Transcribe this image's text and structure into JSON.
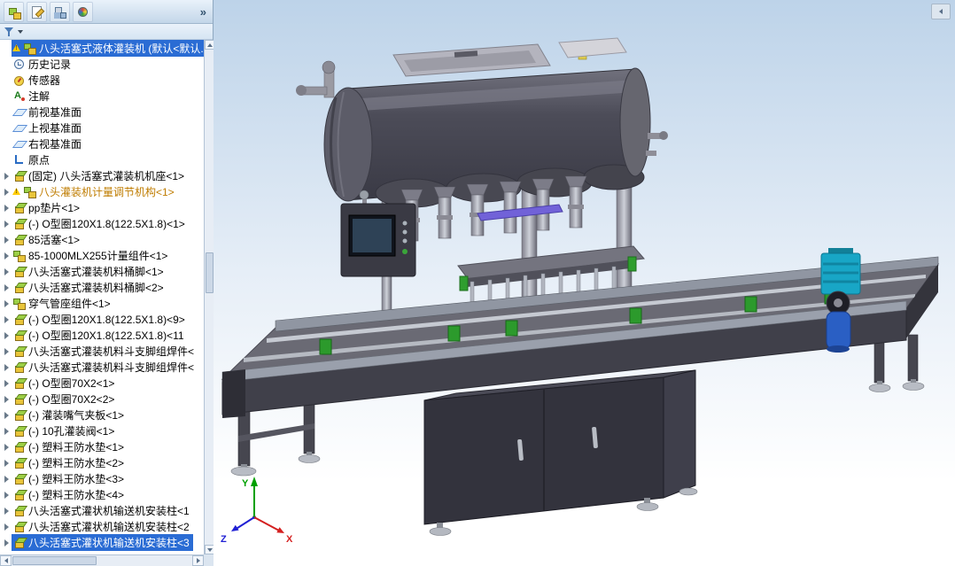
{
  "colors": {
    "selection": "#2a6cd4",
    "warning_text": "#bf7c00"
  },
  "toolbar": {
    "icons": [
      "featuremanager",
      "propertymanager",
      "configurationmanager",
      "displaymanager"
    ],
    "overflow_label": "»"
  },
  "tree": {
    "items": [
      {
        "label": "八头活塞式液体灌装机 (默认<默认...",
        "icon": "asm",
        "warn": true,
        "selected": true
      },
      {
        "label": "历史记录",
        "icon": "history"
      },
      {
        "label": "传感器",
        "icon": "sensor"
      },
      {
        "label": "注解",
        "icon": "annotation"
      },
      {
        "label": "前视基准面",
        "icon": "plane"
      },
      {
        "label": "上视基准面",
        "icon": "plane"
      },
      {
        "label": "右视基准面",
        "icon": "plane"
      },
      {
        "label": "原点",
        "icon": "origin"
      },
      {
        "label": "(固定) 八头活塞式灌装机机座<1>",
        "icon": "part",
        "arrow": true
      },
      {
        "label": "八头灌装机计量调节机构<1>",
        "icon": "asm",
        "arrow": true,
        "warn": true,
        "warntext": true
      },
      {
        "label": "pp垫片<1>",
        "icon": "part",
        "arrow": true
      },
      {
        "label": "(-) O型圈120X1.8(122.5X1.8)<1>",
        "icon": "part",
        "arrow": true
      },
      {
        "label": "85活塞<1>",
        "icon": "part",
        "arrow": true
      },
      {
        "label": "85-1000MLX255计量组件<1>",
        "icon": "asm",
        "arrow": true
      },
      {
        "label": "八头活塞式灌装机料桶脚<1>",
        "icon": "part",
        "arrow": true
      },
      {
        "label": "八头活塞式灌装机料桶脚<2>",
        "icon": "part",
        "arrow": true
      },
      {
        "label": "穿气管座组件<1>",
        "icon": "asm",
        "arrow": true
      },
      {
        "label": "(-) O型圈120X1.8(122.5X1.8)<9>",
        "icon": "part",
        "arrow": true
      },
      {
        "label": "(-) O型圈120X1.8(122.5X1.8)<11",
        "icon": "part",
        "arrow": true
      },
      {
        "label": "八头活塞式灌装机料斗支脚组焊件<",
        "icon": "part",
        "arrow": true
      },
      {
        "label": "八头活塞式灌装机料斗支脚组焊件<",
        "icon": "part",
        "arrow": true
      },
      {
        "label": "(-) O型圈70X2<1>",
        "icon": "part",
        "arrow": true
      },
      {
        "label": "(-) O型圈70X2<2>",
        "icon": "part",
        "arrow": true
      },
      {
        "label": "(-) 灌装嘴气夹板<1>",
        "icon": "part",
        "arrow": true
      },
      {
        "label": "(-) 10孔灌装阀<1>",
        "icon": "part",
        "arrow": true
      },
      {
        "label": "(-) 塑料王防水垫<1>",
        "icon": "part",
        "arrow": true
      },
      {
        "label": "(-) 塑料王防水垫<2>",
        "icon": "part",
        "arrow": true
      },
      {
        "label": "(-) 塑料王防水垫<3>",
        "icon": "part",
        "arrow": true
      },
      {
        "label": "(-) 塑料王防水垫<4>",
        "icon": "part",
        "arrow": true
      },
      {
        "label": "八头活塞式灌状机输送机安装柱<1",
        "icon": "part",
        "arrow": true
      },
      {
        "label": "八头活塞式灌状机输送机安装柱<2",
        "icon": "part",
        "arrow": true
      },
      {
        "label": "八头活塞式灌状机输送机安装柱<3",
        "icon": "part",
        "arrow": true,
        "selected": true
      }
    ]
  },
  "viewport": {
    "bg_top": "#bdd3e9",
    "bg_mid": "#e6eef7",
    "bg_bottom": "#ffffff",
    "axis_labels": {
      "x": "X",
      "y": "Y",
      "z": "Z"
    }
  }
}
